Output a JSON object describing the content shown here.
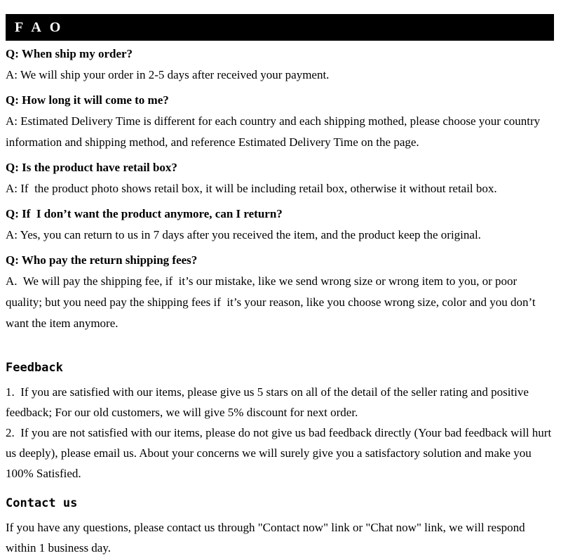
{
  "banner": {
    "title": "F A O"
  },
  "faq": {
    "items": [
      {
        "question": "Q: When ship my order?",
        "answer": "A: We will ship your order in 2-5 days after received your payment."
      },
      {
        "question": "Q: How long it will come to me?",
        "answer": "A: Estimated Delivery Time is different for each country and each shipping mothed, please choose your country information and shipping method, and reference Estimated Delivery Time on the page."
      },
      {
        "question": "Q: Is the product have retail box?",
        "answer": "A: If  the product photo shows retail box, it will be including retail box, otherwise it without retail box."
      },
      {
        "question": "Q: If  I don’t want the product anymore, can I return?",
        "answer": "A: Yes, you can return to us in 7 days after you received the item, and the product keep the original."
      },
      {
        "question": "Q: Who pay the return shipping fees?",
        "answer": "A.  We will pay the shipping fee, if  it’s our mistake, like we send wrong size or wrong item to you, or poor quality; but you need pay the shipping fees if  it’s your reason, like you choose wrong size, color and you don’t want the item anymore."
      }
    ]
  },
  "feedback": {
    "heading": "Feedback",
    "item_1": "1.  If you are satisfied with our items, please give us 5 stars on all of the detail of the seller rating and positive feedback; For our old customers, we will give 5% discount for next order.",
    "item_2": "2.  If you are not satisfied with our items, please do not give us bad feedback directly (Your bad feedback will hurt us deeply), please email us. About your concerns we will surely give you a satisfactory solution and make you 100% Satisfied."
  },
  "contact": {
    "heading": "Contact us",
    "paragraph": "If you have any questions, please contact us through \"Contact now\" link or \"Chat now\" link, we will respond within 1 business day."
  },
  "colors": {
    "banner_background": "#000000",
    "banner_text": "#ffffff",
    "page_background": "#ffffff",
    "body_text": "#000000"
  }
}
